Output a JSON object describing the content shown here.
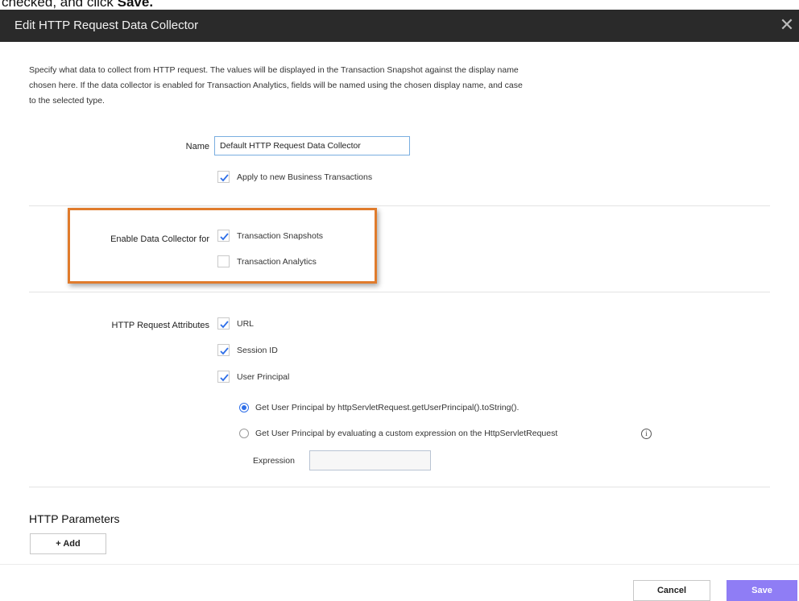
{
  "caption": {
    "text": "checked, and click ",
    "bold": "Save."
  },
  "dialog": {
    "title": "Edit HTTP Request Data Collector"
  },
  "description": "Specify what data to collect from HTTP request. The values will be displayed in the Transaction Snapshot against the display name chosen here. If the data collector is enabled for Transaction Analytics, fields will be named using the chosen display name, and case to the selected type.",
  "name_field": {
    "label": "Name",
    "value": "Default HTTP Request Data Collector"
  },
  "apply_new_bt": {
    "label": "Apply to new Business Transactions",
    "checked": true
  },
  "enable_for": {
    "label": "Enable Data Collector for",
    "snapshots": {
      "label": "Transaction Snapshots",
      "checked": true
    },
    "analytics": {
      "label": "Transaction Analytics",
      "checked": false
    }
  },
  "attributes": {
    "label": "HTTP Request Attributes",
    "url": {
      "label": "URL",
      "checked": true
    },
    "session_id": {
      "label": "Session ID",
      "checked": true
    },
    "user_principal": {
      "label": "User Principal",
      "checked": true
    },
    "principal_tostring": {
      "label": "Get User Principal by httpServletRequest.getUserPrincipal().toString().",
      "selected": true
    },
    "principal_custom": {
      "label": "Get User Principal by evaluating a custom expression on the HttpServletRequest",
      "selected": false
    },
    "expression": {
      "label": "Expression",
      "value": ""
    }
  },
  "http_parameters": {
    "title": "HTTP Parameters",
    "add_label": "+ Add"
  },
  "buttons": {
    "cancel": "Cancel",
    "save": "Save"
  },
  "colors": {
    "accent": "#8f7df5",
    "highlight": "#e07b2c",
    "check": "#2f6fe8",
    "titlebar": "#2a2a2a"
  }
}
